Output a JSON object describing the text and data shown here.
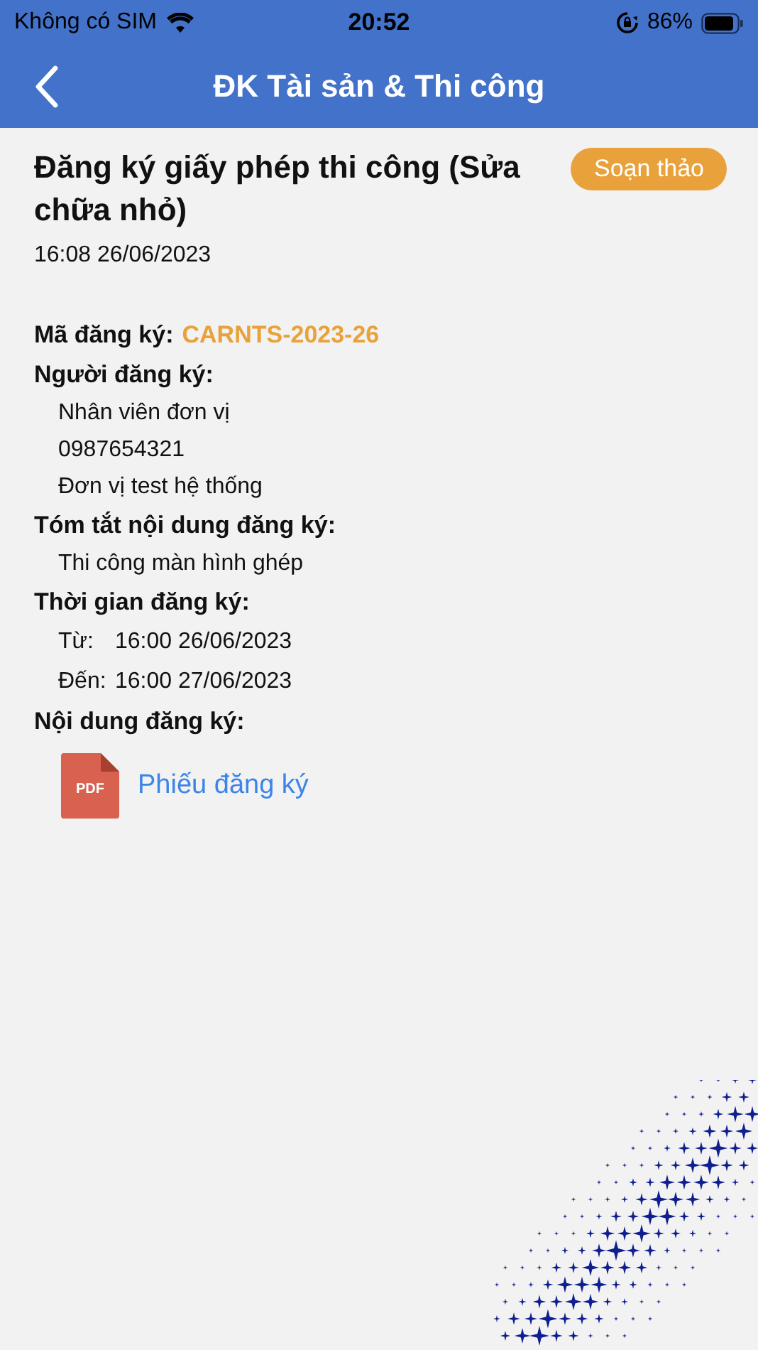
{
  "status_bar": {
    "carrier": "Không có SIM",
    "time": "20:52",
    "battery": "86%"
  },
  "nav_bar": {
    "title": "ĐK Tài sản & Thi công"
  },
  "record": {
    "title": "Đăng ký giấy phép thi công (Sửa chữa nhỏ)",
    "status_button": "Soạn thảo",
    "created": "16:08 26/06/2023",
    "fields": [
      {
        "kind": "code",
        "label": "Mã đăng ký:",
        "value": "CARNTS-2023-26"
      },
      {
        "kind": "lines",
        "label": "Người đăng ký:",
        "lines": [
          "Nhân viên đơn vị",
          "0987654321",
          "Đơn vị test hệ thống"
        ]
      },
      {
        "kind": "lines",
        "label": "Tóm tắt nội dung đăng ký:",
        "lines": [
          "Thi công màn hình ghép"
        ]
      },
      {
        "kind": "range",
        "label": "Thời gian đăng ký:",
        "rows": [
          {
            "label": "Từ:",
            "value": "16:00 26/06/2023"
          },
          {
            "label": "Đến:",
            "value": "16:00 27/06/2023"
          }
        ]
      },
      {
        "kind": "attachment",
        "label": "Nội dung đăng ký:",
        "file": {
          "badge": "PDF",
          "name": "Phiếu đăng ký"
        }
      }
    ]
  }
}
